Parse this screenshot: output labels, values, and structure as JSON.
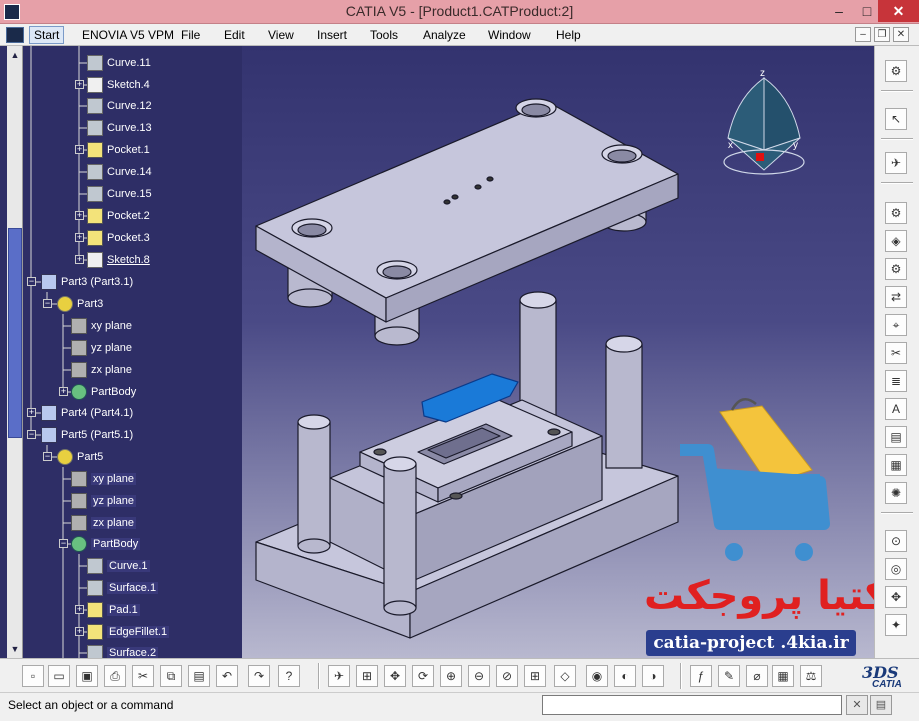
{
  "window": {
    "title": "CATIA V5 - [Product1.CATProduct:2]",
    "minimize": "–",
    "maximize": "□",
    "close": "✕"
  },
  "menu": {
    "items": [
      "Start",
      "ENOVIA V5 VPM",
      "File",
      "Edit",
      "View",
      "Insert",
      "Tools",
      "Analyze",
      "Window",
      "Help"
    ],
    "mdi_min": "–",
    "mdi_restore": "❐",
    "mdi_close": "✕"
  },
  "tree": {
    "nodes": [
      {
        "label": "Curve.11",
        "type": "curve"
      },
      {
        "label": "Sketch.4",
        "type": "sketch"
      },
      {
        "label": "Curve.12",
        "type": "curve"
      },
      {
        "label": "Curve.13",
        "type": "curve"
      },
      {
        "label": "Pocket.1",
        "type": "folder"
      },
      {
        "label": "Curve.14",
        "type": "curve"
      },
      {
        "label": "Curve.15",
        "type": "curve"
      },
      {
        "label": "Pocket.2",
        "type": "folder"
      },
      {
        "label": "Pocket.3",
        "type": "folder"
      },
      {
        "label": "Sketch.8",
        "type": "sketch"
      },
      {
        "label": "Part3 (Part3.1)",
        "type": "part"
      },
      {
        "label": "Part3",
        "type": "gear"
      },
      {
        "label": "xy plane",
        "type": "plane"
      },
      {
        "label": "yz plane",
        "type": "plane"
      },
      {
        "label": "zx plane",
        "type": "plane"
      },
      {
        "label": "PartBody",
        "type": "body"
      },
      {
        "label": "Part4 (Part4.1)",
        "type": "part"
      },
      {
        "label": "Part5 (Part5.1)",
        "type": "part"
      },
      {
        "label": "Part5",
        "type": "gear"
      },
      {
        "label": "xy plane",
        "type": "plane"
      },
      {
        "label": "yz plane",
        "type": "plane"
      },
      {
        "label": "zx plane",
        "type": "plane"
      },
      {
        "label": "PartBody",
        "type": "body"
      },
      {
        "label": "Curve.1",
        "type": "curve"
      },
      {
        "label": "Surface.1",
        "type": "curve"
      },
      {
        "label": "Pad.1",
        "type": "folder"
      },
      {
        "label": "EdgeFillet.1",
        "type": "folder"
      },
      {
        "label": "Surface.2",
        "type": "curve"
      }
    ]
  },
  "compass": {
    "x": "x",
    "y": "y",
    "z": "z"
  },
  "watermark": {
    "brand_fa": "کتیا پروجکت",
    "url": "catia-project .4kia.ir"
  },
  "bottom_logo": {
    "mark": "3DS",
    "name": "CATIA"
  },
  "status": {
    "message": "Select an object or a command",
    "command_value": ""
  },
  "colors": {
    "titlebar": "#e6a0a8",
    "viewport_top": "#33336f",
    "viewport_bottom": "#b8b8cf",
    "watermark_red": "#e02020",
    "watermark_blue": "#2a3e8e",
    "cart_blue": "#3f8fd0",
    "bag_yellow": "#f4c43c"
  }
}
